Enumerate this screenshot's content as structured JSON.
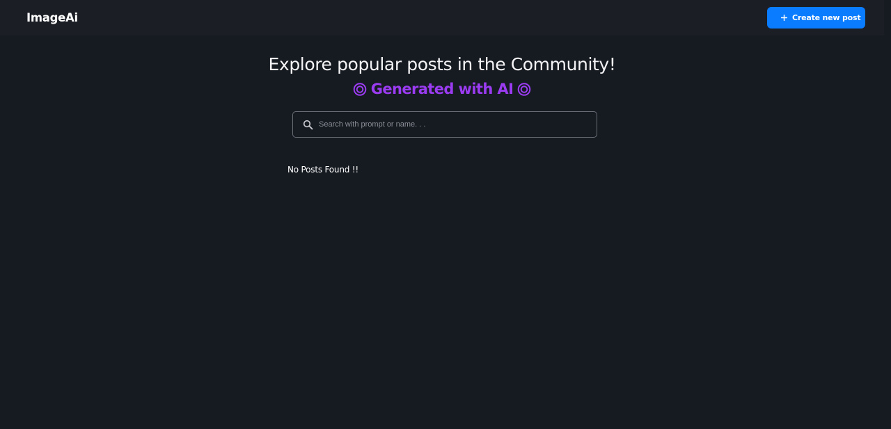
{
  "navbar": {
    "logo": "ImageAi",
    "create_button": {
      "label": "Create new post",
      "icon": "plus-icon"
    }
  },
  "hero": {
    "title": "Explore popular posts in the Community!",
    "subtitle": "Generated with AI",
    "subtitle_icon": "target-icon"
  },
  "search": {
    "placeholder": "Search with prompt or name. . .",
    "value": "",
    "icon": "search-icon"
  },
  "results": {
    "empty_message": "No Posts Found !!"
  },
  "colors": {
    "background": "#161a21",
    "navbar": "#1c1e26",
    "accent_button": "#0a7cff",
    "subtitle": "#9b3cf2"
  }
}
